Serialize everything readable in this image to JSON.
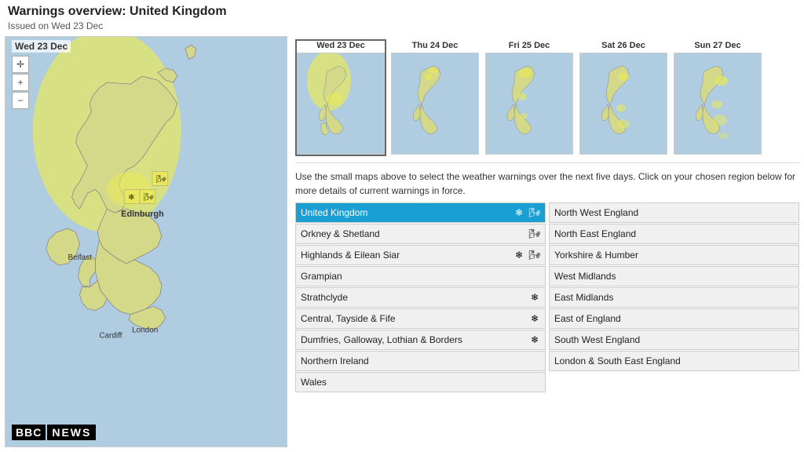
{
  "page": {
    "title": "Warnings overview: United Kingdom",
    "subtitle": "Issued on Wed 23 Dec"
  },
  "map": {
    "label": "Wed 23 Dec",
    "controls": {
      "pan": "✛",
      "zoom_in": "+",
      "zoom_out": "−"
    }
  },
  "bbc_logo": {
    "bbc": "BBC",
    "news": "NEWS"
  },
  "dates": [
    {
      "label": "Wed 23 Dec",
      "active": true
    },
    {
      "label": "Thu 24 Dec",
      "active": false
    },
    {
      "label": "Fri 25 Dec",
      "active": false
    },
    {
      "label": "Sat 26 Dec",
      "active": false
    },
    {
      "label": "Sun 27 Dec",
      "active": false
    }
  ],
  "description": "Use the small maps above to select the weather warnings over the next five days. Click on your chosen region below for more details of current warnings in force.",
  "regions_left": [
    {
      "name": "United Kingdom",
      "icons": [
        "snow",
        "wind"
      ],
      "active": true
    },
    {
      "name": "Orkney & Shetland",
      "icons": [
        "wind"
      ],
      "active": false
    },
    {
      "name": "Highlands & Eilean Siar",
      "icons": [
        "snow",
        "wind"
      ],
      "active": false
    },
    {
      "name": "Grampian",
      "icons": [],
      "active": false
    },
    {
      "name": "Strathclyde",
      "icons": [
        "snow"
      ],
      "active": false
    },
    {
      "name": "Central, Tayside & Fife",
      "icons": [
        "snow"
      ],
      "active": false
    },
    {
      "name": "Dumfries, Galloway, Lothian & Borders",
      "icons": [
        "snow"
      ],
      "active": false
    },
    {
      "name": "Northern Ireland",
      "icons": [],
      "active": false
    },
    {
      "name": "Wales",
      "icons": [],
      "active": false
    }
  ],
  "regions_right": [
    {
      "name": "North West England",
      "icons": [],
      "active": false
    },
    {
      "name": "North East England",
      "icons": [],
      "active": false
    },
    {
      "name": "Yorkshire & Humber",
      "icons": [],
      "active": false
    },
    {
      "name": "West Midlands",
      "icons": [],
      "active": false
    },
    {
      "name": "East Midlands",
      "icons": [],
      "active": false
    },
    {
      "name": "East of England",
      "icons": [],
      "active": false
    },
    {
      "name": "South West England",
      "icons": [],
      "active": false
    },
    {
      "name": "London & South East England",
      "icons": [],
      "active": false
    }
  ]
}
